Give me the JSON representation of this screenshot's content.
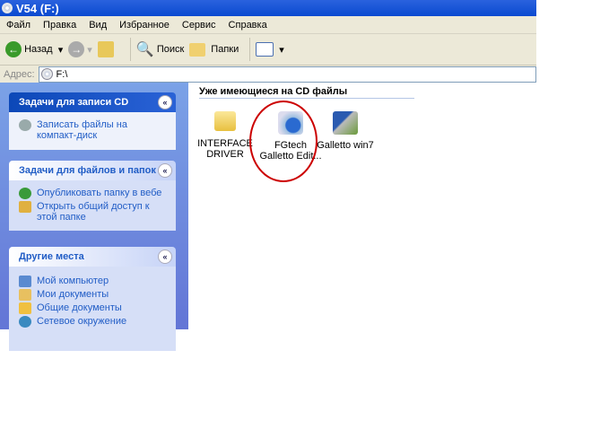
{
  "window": {
    "title": "V54 (F:)"
  },
  "menu": [
    "Файл",
    "Правка",
    "Вид",
    "Избранное",
    "Сервис",
    "Справка"
  ],
  "toolbar": {
    "back": "Назад",
    "search": "Поиск",
    "folders": "Папки"
  },
  "address": {
    "label": "Адрес:",
    "value": "F:\\"
  },
  "panels": [
    {
      "title": "Задачи для записи CD",
      "items": [
        "Записать файлы на компакт-диск"
      ]
    },
    {
      "title": "Задачи для файлов и папок",
      "items": [
        "Опубликовать папку в вебе",
        "Открыть общий доступ к этой папке"
      ]
    },
    {
      "title": "Другие места",
      "items": [
        "Мой компьютер",
        "Мои документы",
        "Общие документы",
        "Сетевое окружение"
      ]
    }
  ],
  "group_title": "Уже имеющиеся на CD файлы",
  "files": [
    {
      "name": "INTERFACE DRIVER",
      "icon": "folder-icon"
    },
    {
      "name": "FGtech Galletto Edit...",
      "icon": "app-icon"
    },
    {
      "name": "Galletto win7",
      "icon": "installer-icon"
    }
  ]
}
